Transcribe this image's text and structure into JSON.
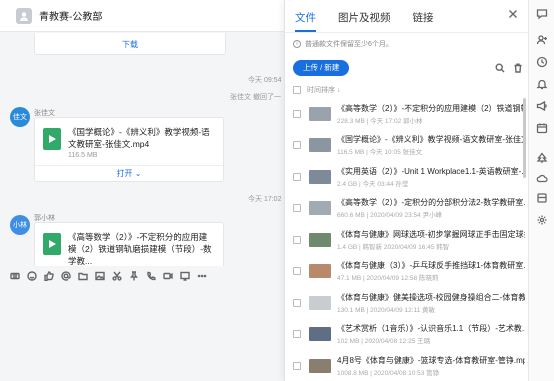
{
  "chat": {
    "title": "青教赛-公教部",
    "top_card_link": "下载",
    "ts1": "今天 09:54",
    "sysnote": "张佳文 撤回了一",
    "msg1": {
      "sender": "张佳文",
      "avatar_text": "佳文",
      "file_name": "《国学概论》-《辨义利》教学视频-语文教研室-张佳文.mp4",
      "file_size": "116.5 MB",
      "open_label": "打开 ⌄"
    },
    "ts2": "今天 17:02",
    "msg2": {
      "sender": "郭小林",
      "avatar_text": "小林",
      "file_name": "《高等数学（2）》-不定积分的应用建模（2）铁道钢轨磨损建模（节段）-数学教..."
    }
  },
  "toolbar_icons": [
    "keyboard-icon",
    "emoji-icon",
    "thumbs-up-icon",
    "mention-icon",
    "folder-icon",
    "image-icon",
    "scissors-icon",
    "pin-icon",
    "call-icon",
    "video-icon",
    "screen-icon",
    "more-icon"
  ],
  "panel": {
    "tabs": [
      "文件",
      "图片及视频",
      "链接"
    ],
    "active_tab": 0,
    "notice": "普通款文件保留至少6个月。",
    "upload_label": "上传 / 新建",
    "sort_label": "时间排序 ↓",
    "files": [
      {
        "name": "《高等数学（2）》-不定积分的应用建模（2）铁道钢轨...",
        "meta": "228.3 MB  |  今天 17:02  郭小林",
        "thumb": "#9aa3ad"
      },
      {
        "name": "《国学概论》-《辨义利》教学视频-语文教研室-张佳文...",
        "meta": "116.5 MB  |  今天 10:05  张佳文",
        "thumb": "#8c96a3"
      },
      {
        "name": "《实用英语（2）》-Unit 1 Workplace1.1-英语教研室-...",
        "meta": "2.4 GB  |  今天 03:44  孙莹",
        "thumb": "#7d8a97"
      },
      {
        "name": "《高等数学（2）》-定积分的分部积分法2-数学教研室...",
        "meta": "660.6 MB  |  2020/04/09 23:54  尹小峰",
        "thumb": "#a2aab2"
      },
      {
        "name": "《体育与健康》网球选项-初步掌握网球正手击固定球技...",
        "meta": "1.4 GB  |  韩智新  2020/04/09 16:45  韩智",
        "thumb": "#6f8a6c"
      },
      {
        "name": "《体育与健康（3）》-乒乓球反手推挡球1-体育教研室...",
        "meta": "47.1 MB  |  2020/04/09 12:58  陈晓莉",
        "thumb": "#b98a6a"
      },
      {
        "name": "《体育与健康》健美操选项-校园健身操组合二-体育教研...",
        "meta": "130.1 MB  |  2020/04/09 12:11  黄敏",
        "thumb": "#c9cdd2"
      },
      {
        "name": "《艺术赏析（1音乐）》-认识音乐1.1（节段）-艺术教...",
        "meta": "102 MB  |  2020/04/08 12:25  王璐",
        "thumb": "#5d6e85"
      },
      {
        "name": "4月8号《体育与健康》-篮球专选-体育教研室-管铮.mp4",
        "meta": "1008.8 MB  |  2020/04/08 10:53  管铮",
        "thumb": "#8a7f6e"
      }
    ]
  },
  "rail_icons": [
    "chat-bubble-icon",
    "add-person-icon",
    "history-icon",
    "bell-icon",
    "announcement-icon",
    "calendar-icon",
    "tree-icon",
    "cloud-icon",
    "box-icon",
    "settings-icon"
  ]
}
